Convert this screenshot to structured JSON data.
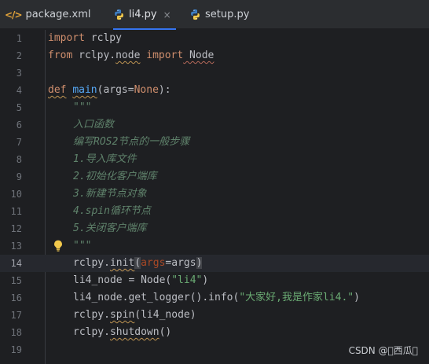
{
  "tabs": [
    {
      "label": "package.xml",
      "icon": "xml-icon",
      "active": false
    },
    {
      "label": "li4.py",
      "icon": "python-icon",
      "active": true,
      "close": "×"
    },
    {
      "label": "setup.py",
      "icon": "python-icon",
      "active": false
    }
  ],
  "editor": {
    "current_line": 14,
    "lines": [
      {
        "n": "1"
      },
      {
        "n": "2"
      },
      {
        "n": "3"
      },
      {
        "n": "4"
      },
      {
        "n": "5"
      },
      {
        "n": "6"
      },
      {
        "n": "7"
      },
      {
        "n": "8"
      },
      {
        "n": "9"
      },
      {
        "n": "10"
      },
      {
        "n": "11"
      },
      {
        "n": "12"
      },
      {
        "n": "13"
      },
      {
        "n": "14"
      },
      {
        "n": "15"
      },
      {
        "n": "16"
      },
      {
        "n": "17"
      },
      {
        "n": "18"
      },
      {
        "n": "19"
      }
    ],
    "tokens": {
      "l1_import": "import",
      "l1_mod": " rclpy",
      "l2_from": "from",
      "l2_mod": " rclpy.",
      "l2_node": "node",
      "l2_import": " import",
      "l2_Node": " Node",
      "l4_def": "def",
      "l4_main": "main",
      "l4_open": "(args=",
      "l4_none": "None",
      "l4_close": "):",
      "l5": "\"\"\"",
      "l6": "入口函数",
      "l7": "编写ROS2节点的一般步骤",
      "l8": "1.导入库文件",
      "l9": "2.初始化客户端库",
      "l10": "3.新建节点对象",
      "l11": "4.spin循环节点",
      "l12": "5.关闭客户端库",
      "l13": "\"\"\"",
      "l14_a": "rclpy.",
      "l14_init": "init",
      "l14_open": "(",
      "l14_args": "args",
      "l14_eq": "=args",
      "l14_close": ")",
      "l15_a": "li4_node = Node(",
      "l15_str": "\"li4\"",
      "l15_b": ")",
      "l16_a": "li4_node.get_logger().info(",
      "l16_str": "\"大家好,我是作家li4.\"",
      "l16_b": ")",
      "l17_a": "rclpy.",
      "l17_spin": "spin",
      "l17_b": "(li4_node)",
      "l18_a": "rclpy.",
      "l18_shut": "shutdown",
      "l18_b": "()"
    }
  },
  "watermark": "CSDN @\u0000西瓜\u0000",
  "colors": {
    "background": "#1e1f22",
    "keyword": "#cf8e6d",
    "function": "#56a8f5",
    "string": "#6aab73",
    "docstring": "#5f826b",
    "accent": "#3574f0"
  }
}
